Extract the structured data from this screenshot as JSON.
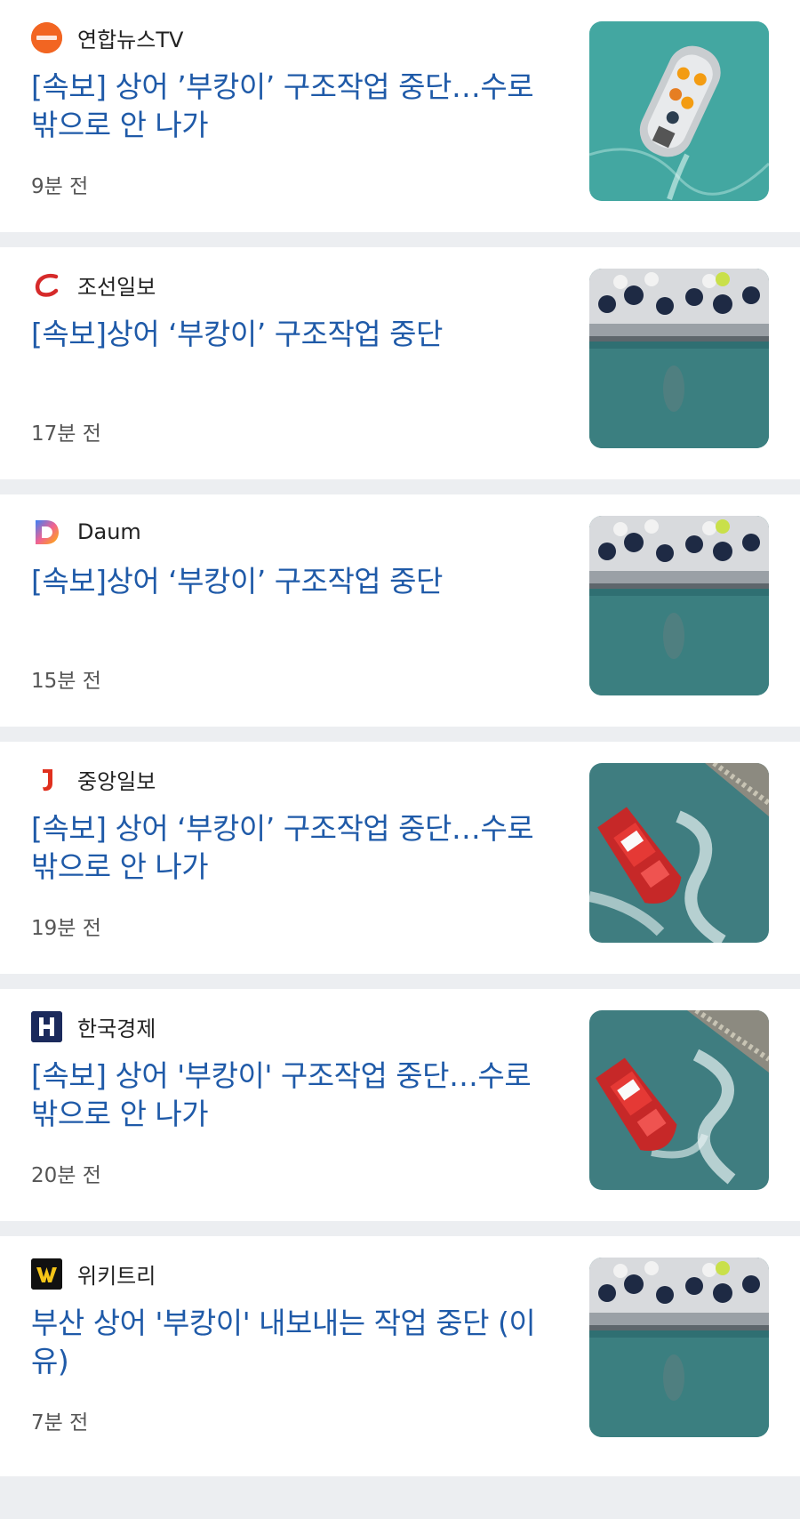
{
  "articles": [
    {
      "source": "연합뉴스TV",
      "logo_icon": "yonhap-tv-logo-icon",
      "logo_color": "#f26522",
      "title": "[속보] 상어 ’부캉이’ 구조작업 중단…수로 밖으로 안 나가",
      "time": "9분 전",
      "thumb": "boat-rescue-image"
    },
    {
      "source": "조선일보",
      "logo_icon": "chosun-logo-icon",
      "logo_color": "#d62a2a",
      "title": "[속보]상어 ‘부캉이’ 구조작업 중단",
      "time": "17분 전",
      "thumb": "pier-crowd-shark-image"
    },
    {
      "source": "Daum",
      "logo_icon": "daum-logo-icon",
      "logo_color": "#3b82f6",
      "title": "[속보]상어 ‘부캉이’ 구조작업 중단",
      "time": "15분 전",
      "thumb": "pier-crowd-shark-image"
    },
    {
      "source": "중앙일보",
      "logo_icon": "joongang-logo-icon",
      "logo_color": "#e0301e",
      "title": "[속보] 상어 ‘부캉이’ 구조작업 중단…수로 밖으로 안 나가",
      "time": "19분 전",
      "thumb": "red-boat-image"
    },
    {
      "source": "한국경제",
      "logo_icon": "hankyung-logo-icon",
      "logo_color": "#1b2a5c",
      "title": "[속보] 상어 '부캉이' 구조작업 중단…수로 밖으로 안 나가",
      "time": "20분 전",
      "thumb": "red-boat-image"
    },
    {
      "source": "위키트리",
      "logo_icon": "wikitree-logo-icon",
      "logo_color": "#111111",
      "title": "부산 상어 '부캉이' 내보내는 작업 중단 (이유)",
      "time": "7분 전",
      "thumb": "pier-crowd-shark-image"
    }
  ]
}
